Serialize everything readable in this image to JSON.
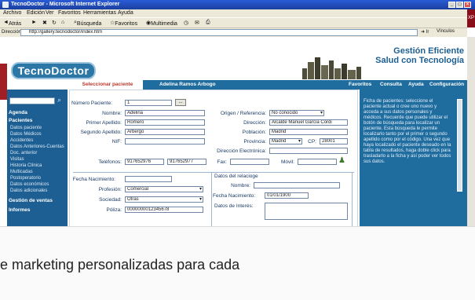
{
  "window": {
    "title": "TecnoDoctor - Microsoft Internet Explorer",
    "badge": "XP"
  },
  "menu": [
    "Archivo",
    "Edición",
    "Ver",
    "Favoritos",
    "Herramientas",
    "Ayuda"
  ],
  "toolbar": {
    "back": "Atrás",
    "search": "Búsqueda",
    "favorites": "Favoritos",
    "multimedia": "Multimedia"
  },
  "address": {
    "label": "Dirección",
    "url": "http://gallery.tecnodoctor/index.htm",
    "go": "Ir",
    "links": "Vínculos"
  },
  "header": {
    "logo": "TecnoDoctor",
    "brand_line1": "Gestión Eficiente",
    "brand_line2": "Salud con Tecnología"
  },
  "nav": {
    "tabs": [
      {
        "label": "Seleccionar paciente"
      },
      {
        "label": "Adelina Ramos Arbogo"
      }
    ],
    "links": [
      "Favoritos",
      "Consulta",
      "Ayuda",
      "Configuración"
    ]
  },
  "sidebar": {
    "sections": [
      {
        "title": "Agenda"
      },
      {
        "title": "Pacientes",
        "items": [
          "Datos paciente",
          "Datos Médicos",
          "Accidentes",
          "Datos Anteriores-Cuentas",
          "Doc. anterior",
          "Visitas",
          "Historia Clínica",
          "Multicadas",
          "Postoperatorio",
          "Datos económicos",
          "Datos adicionales"
        ]
      },
      {
        "title": "Gestión de ventas"
      },
      {
        "title": "Informes"
      }
    ]
  },
  "form": {
    "numero_paciente": {
      "label": "Número Paciente:",
      "value": "1",
      "button": "..."
    },
    "nombre": {
      "label": "Nombre:",
      "value": "Adelina"
    },
    "primer_apellido": {
      "label": "Primer Apellido:",
      "value": "Romero"
    },
    "segundo_apellido": {
      "label": "Segundo Apellido:",
      "value": "Arbergo"
    },
    "nif": {
      "label": "NIF:",
      "value": ""
    },
    "origen": {
      "label": "Origen / Referencia:",
      "value": "No conocido"
    },
    "direccion": {
      "label": "Dirección:",
      "value": "Alcalde Manuel García Cordi"
    },
    "poblacion": {
      "label": "Población:",
      "value": "Madrid"
    },
    "provincia": {
      "label": "Provincia:",
      "value": "Madrid"
    },
    "cp": {
      "label": "CP:",
      "value": "28001"
    },
    "email": {
      "label": "Dirección Electrónica:",
      "value": ""
    },
    "telefonos": {
      "label": "Teléfonos:",
      "value1": "917652976",
      "value2": "917652977"
    },
    "fax": {
      "label": "Fax:",
      "value": ""
    },
    "movil": {
      "label": "Móvil:",
      "value": ""
    },
    "fecha_nacimiento": {
      "label": "Fecha Nacimiento:",
      "value": ""
    },
    "profesion": {
      "label": "Profesión:",
      "value": "Comercial"
    },
    "sociedad": {
      "label": "Sociedad:",
      "value": "Otras"
    },
    "poliza": {
      "label": "Póliza:",
      "value": "0000000012345678"
    },
    "relacion": {
      "title": "Datos del relacioge",
      "nombre_label": "Nombre:",
      "nombre_value": "",
      "fecha_label": "Fecha Nacimiento:",
      "fecha_value": "01/01/1900",
      "interes_label": "Datos de Interés:",
      "interes_value": ""
    }
  },
  "help": {
    "text": "Ficha de pacientes: seleccione el paciente actual o cree uno nuevo y acceda a sus datos personales y médicos. Recuerde que puede utilizar el botón de búsqueda para localizar un paciente. Esta búsqueda le permite localizarlo tanto por el primer o segundo apellido como por el código. Una vez que haya localizado el paciente deseado en la tabla de resultados, haga doble click para trasladarlo a la ficha y así poder ver todos sus datos."
  },
  "caption": {
    "text": "e marketing personalizadas para cada"
  },
  "colors": {
    "brand_blue": "#1d5f93",
    "nav_blue": "#1f6c9f",
    "accent_red": "#a01e24"
  }
}
